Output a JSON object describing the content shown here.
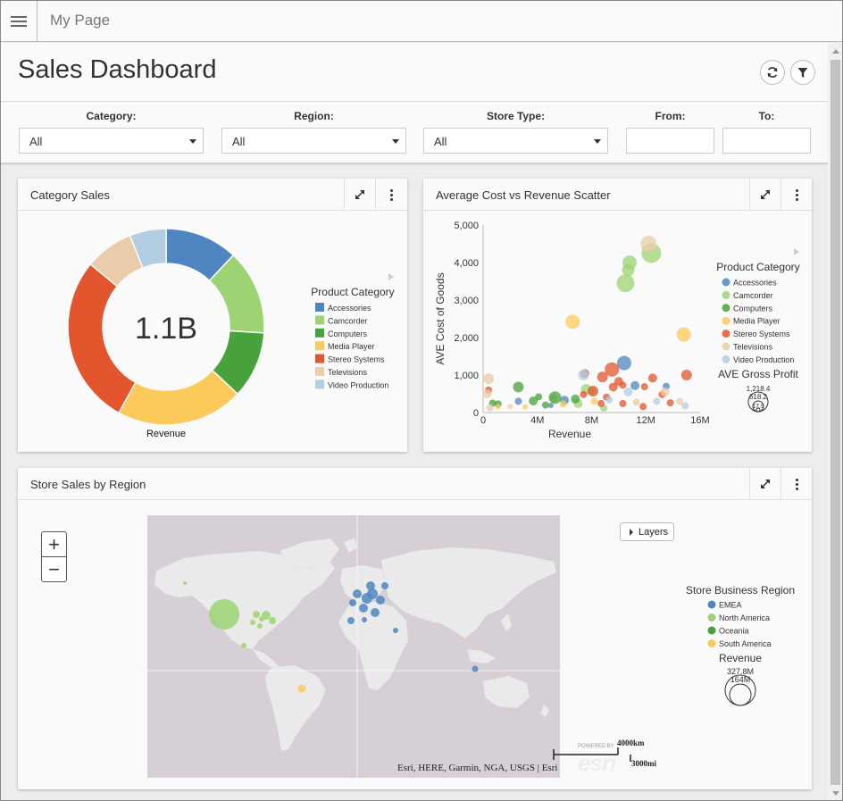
{
  "app": {
    "page_label": "My Page"
  },
  "dashboard": {
    "title": "Sales Dashboard",
    "refresh_icon": "refresh-icon",
    "filter_icon": "filter-icon"
  },
  "filters": {
    "category": {
      "label": "Category:",
      "value": "All"
    },
    "region": {
      "label": "Region:",
      "value": "All"
    },
    "store_type": {
      "label": "Store Type:",
      "value": "All"
    },
    "from": {
      "label": "From:",
      "value": ""
    },
    "to": {
      "label": "To:",
      "value": ""
    }
  },
  "panels": {
    "category_sales": {
      "title": "Category Sales"
    },
    "scatter": {
      "title": "Average Cost vs Revenue Scatter"
    },
    "map": {
      "title": "Store Sales by Region"
    }
  },
  "map": {
    "layers_label": "Layers",
    "zoom_in": "+",
    "zoom_out": "−",
    "attribution": "Esri, HERE, Garmin, NGA, USGS | Esri",
    "powered_by": "POWERED BY",
    "esri_logo": "esri",
    "scale_km": "4000km",
    "scale_mi": "3000mi"
  },
  "colors": {
    "accessories": "#4f86c1",
    "camcorder": "#9cd474",
    "computers": "#48a23c",
    "media_player": "#fcca5a",
    "stereo_systems": "#e2552d",
    "televisions": "#ebccaa",
    "video_production": "#b3cde3"
  },
  "chart_data": [
    {
      "type": "pie",
      "variant": "donut",
      "center_label": "1.1B",
      "xlabel": "Revenue",
      "legend_title": "Product Category",
      "legend_position": "right",
      "categories": [
        "Accessories",
        "Camcorder",
        "Computers",
        "Media Player",
        "Stereo Systems",
        "Televisions",
        "Video Production"
      ],
      "values": [
        0.12,
        0.14,
        0.11,
        0.21,
        0.28,
        0.08,
        0.06
      ],
      "colors": [
        "#4f86c1",
        "#9cd474",
        "#48a23c",
        "#fcca5a",
        "#e2552d",
        "#ebccaa",
        "#b3cde3"
      ]
    },
    {
      "type": "scatter",
      "xlabel": "Revenue",
      "ylabel": "AVE Cost of Goods",
      "x_ticks": [
        "0",
        "4M",
        "8M",
        "12M",
        "16M"
      ],
      "y_ticks": [
        "0",
        "1,000",
        "2,000",
        "3,000",
        "4,000",
        "5,000"
      ],
      "xlim": [
        0,
        16000000
      ],
      "ylim": [
        0,
        5000
      ],
      "legend_title": "Product Category",
      "legend_position": "right",
      "size_legend_title": "AVE Gross Profit",
      "size_legend_values": [
        "1,218.4",
        "618.2",
        "17.9"
      ],
      "series": [
        {
          "name": "Accessories",
          "color": "#4f86c1",
          "points": [
            [
              10.4,
              1320,
              8
            ],
            [
              11.2,
              720,
              5
            ],
            [
              6.0,
              330,
              5
            ],
            [
              2.6,
              300,
              4
            ],
            [
              5.0,
              190,
              3
            ],
            [
              13.5,
              700,
              4
            ]
          ]
        },
        {
          "name": "Camcorder",
          "color": "#9cd474",
          "points": [
            [
              12.4,
              4250,
              11
            ],
            [
              10.5,
              3450,
              10
            ],
            [
              10.8,
              4000,
              8
            ],
            [
              10.7,
              3800,
              7
            ],
            [
              7.6,
              620,
              6
            ],
            [
              8.0,
              580,
              5
            ],
            [
              7.0,
              240,
              5
            ],
            [
              5.2,
              390,
              4
            ],
            [
              8.9,
              120,
              4
            ]
          ]
        },
        {
          "name": "Computers",
          "color": "#48a23c",
          "points": [
            [
              2.6,
              680,
              6
            ],
            [
              5.3,
              400,
              7
            ],
            [
              3.7,
              310,
              5
            ],
            [
              4.1,
              420,
              4
            ],
            [
              6.8,
              360,
              5
            ],
            [
              4.6,
              200,
              4
            ],
            [
              1.1,
              230,
              4
            ],
            [
              0.7,
              250,
              4
            ]
          ]
        },
        {
          "name": "Media Player",
          "color": "#fcca5a",
          "points": [
            [
              6.6,
              2420,
              8
            ],
            [
              14.8,
              2080,
              8
            ],
            [
              1.1,
              160,
              3
            ],
            [
              3.1,
              150,
              3
            ],
            [
              5.9,
              230,
              4
            ],
            [
              8.2,
              300,
              4
            ]
          ]
        },
        {
          "name": "Stereo Systems",
          "color": "#e2552d",
          "points": [
            [
              9.5,
              1150,
              8
            ],
            [
              7.5,
              1040,
              5
            ],
            [
              8.8,
              950,
              6
            ],
            [
              10.0,
              830,
              5
            ],
            [
              8.1,
              570,
              6
            ],
            [
              9.6,
              680,
              5
            ],
            [
              10.3,
              730,
              4
            ],
            [
              12.5,
              920,
              5
            ],
            [
              15.0,
              1000,
              6
            ],
            [
              11.9,
              690,
              4
            ],
            [
              13.2,
              480,
              4
            ],
            [
              9.1,
              410,
              4
            ],
            [
              8.7,
              240,
              4
            ],
            [
              10.3,
              240,
              4
            ],
            [
              11.8,
              160,
              4
            ],
            [
              13.8,
              260,
              4
            ],
            [
              7.4,
              480,
              4
            ],
            [
              0.4,
              600,
              4
            ]
          ]
        },
        {
          "name": "Televisions",
          "color": "#ebccaa",
          "points": [
            [
              12.2,
              4500,
              9
            ],
            [
              0.4,
              900,
              6
            ],
            [
              0.3,
              500,
              5
            ],
            [
              13.4,
              550,
              5
            ],
            [
              11.3,
              280,
              4
            ],
            [
              14.5,
              300,
              4
            ],
            [
              0.5,
              130,
              4
            ],
            [
              2.0,
              160,
              3
            ]
          ]
        },
        {
          "name": "Video Production",
          "color": "#b3cde3",
          "points": [
            [
              7.4,
              1000,
              6
            ],
            [
              10.7,
              550,
              5
            ],
            [
              12.8,
              300,
              4
            ],
            [
              14.9,
              180,
              4
            ],
            [
              9.3,
              340,
              4
            ]
          ]
        }
      ]
    }
  ],
  "map_legend": {
    "region_title": "Store Business Region",
    "regions": [
      {
        "name": "EMEA",
        "color": "#4f86c1"
      },
      {
        "name": "North America",
        "color": "#9cd474"
      },
      {
        "name": "Oceania",
        "color": "#48a23c"
      },
      {
        "name": "South America",
        "color": "#fcca5a"
      }
    ],
    "size_title": "Revenue",
    "size_values": [
      "327.8M",
      "164M"
    ]
  }
}
